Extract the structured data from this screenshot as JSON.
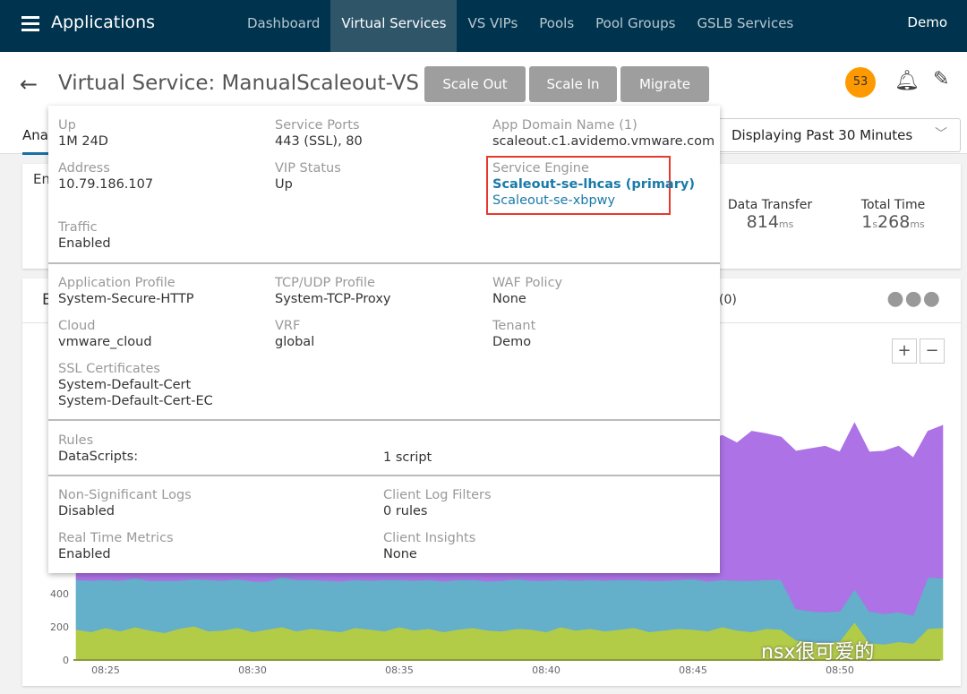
{
  "topbar": {
    "title": "Applications",
    "nav": [
      "Dashboard",
      "Virtual Services",
      "VS VIPs",
      "Pools",
      "Pool Groups",
      "GSLB Services"
    ],
    "active": "Virtual Services",
    "tenant": "Demo"
  },
  "header": {
    "title": "Virtual Service:  ManualScaleout-VS",
    "buttons": [
      "Scale Out",
      "Scale In",
      "Migrate"
    ],
    "alert_count": "53"
  },
  "tabs": {
    "active_partial": "Ana",
    "time_select": "Displaying Past 30 Minutes"
  },
  "summary": {
    "partial_label": "En",
    "metrics": [
      {
        "label": "Data Transfer",
        "value": "814",
        "unit": "ms"
      },
      {
        "label": "Total Time",
        "value_s": "1",
        "unit_s": "s",
        "value": "268",
        "unit": "ms"
      }
    ]
  },
  "events": {
    "partial_title": "E",
    "count": "(0)"
  },
  "popup": {
    "up": {
      "label": "Up",
      "value": "1M 24D"
    },
    "ports": {
      "label": "Service Ports",
      "value": "443 (SSL), 80"
    },
    "domain": {
      "label": "App Domain Name  (1)",
      "value": "scaleout.c1.avidemo.vmware.com"
    },
    "address": {
      "label": "Address",
      "value": "10.79.186.107"
    },
    "vip": {
      "label": "VIP Status",
      "value": "Up"
    },
    "se": {
      "label": "Service Engine",
      "primary": "Scaleout-se-lhcas (primary)",
      "secondary": "Scaleout-se-xbpwy"
    },
    "traffic": {
      "label": "Traffic",
      "value": "Enabled"
    },
    "app_profile": {
      "label": "Application Profile",
      "value": "System-Secure-HTTP"
    },
    "tcp_profile": {
      "label": "TCP/UDP Profile",
      "value": "System-TCP-Proxy"
    },
    "waf": {
      "label": "WAF Policy",
      "value": "None"
    },
    "cloud": {
      "label": "Cloud",
      "value": "vmware_cloud"
    },
    "vrf": {
      "label": "VRF",
      "value": "global"
    },
    "tenant": {
      "label": "Tenant",
      "value": "Demo"
    },
    "ssl": {
      "label": "SSL Certificates",
      "values": [
        "System-Default-Cert",
        "System-Default-Cert-EC"
      ]
    },
    "rules": {
      "label": "Rules",
      "key": "DataScripts:",
      "value": "1 script"
    },
    "nslogs": {
      "label": "Non-Significant Logs",
      "value": "Disabled"
    },
    "clf": {
      "label": "Client Log Filters",
      "value": "0 rules"
    },
    "rtm": {
      "label": "Real Time Metrics",
      "value": "Enabled"
    },
    "ci": {
      "label": "Client Insights",
      "value": "None"
    }
  },
  "watermark": "nsx很可爱的",
  "chart_data": {
    "type": "area",
    "stacked": true,
    "x_start": "08:24:00",
    "x_interval_seconds": 30,
    "x_ticks": [
      "08:25",
      "08:30",
      "08:35",
      "08:40",
      "08:45",
      "08:50"
    ],
    "y_ticks": [
      0,
      200,
      400
    ],
    "ylim": [
      0,
      1500
    ],
    "colors": [
      "#b3cc47",
      "#64afc9",
      "#ad72e6"
    ],
    "series": [
      {
        "values": [
          185,
          170,
          195,
          175,
          200,
          180,
          165,
          190,
          205,
          175,
          180,
          195,
          170,
          185,
          200,
          175,
          190,
          180,
          170,
          195,
          185,
          175,
          200,
          180,
          190,
          170,
          185,
          195,
          180,
          175,
          190,
          185,
          170,
          200,
          180,
          190,
          175,
          185,
          195,
          170,
          180,
          190,
          185,
          175,
          200,
          180,
          170,
          190,
          185,
          120,
          110,
          100,
          115,
          230,
          105,
          95,
          110,
          100,
          190,
          195
        ]
      },
      {
        "values": [
          300,
          310,
          290,
          305,
          295,
          300,
          315,
          290,
          285,
          310,
          300,
          295,
          305,
          290,
          300,
          310,
          295,
          300,
          305,
          290,
          295,
          310,
          285,
          300,
          295,
          305,
          300,
          290,
          295,
          305,
          300,
          295,
          310,
          285,
          300,
          295,
          305,
          300,
          290,
          310,
          300,
          295,
          305,
          300,
          285,
          300,
          310,
          295,
          300,
          190,
          185,
          190,
          180,
          200,
          190,
          185,
          180,
          170,
          310,
          300
        ]
      },
      {
        "values": [
          850,
          880,
          820,
          900,
          860,
          840,
          870,
          890,
          830,
          860,
          880,
          850,
          900,
          840,
          860,
          870,
          850,
          880,
          830,
          900,
          860,
          850,
          870,
          840,
          890,
          860,
          850,
          880,
          900,
          840,
          870,
          860,
          850,
          890,
          830,
          880,
          860,
          870,
          850,
          900,
          840,
          860,
          880,
          850,
          870,
          830,
          900,
          880,
          860,
          950,
          980,
          1000,
          960,
          1000,
          960,
          980,
          1000,
          950,
          880,
          920
        ]
      }
    ]
  }
}
